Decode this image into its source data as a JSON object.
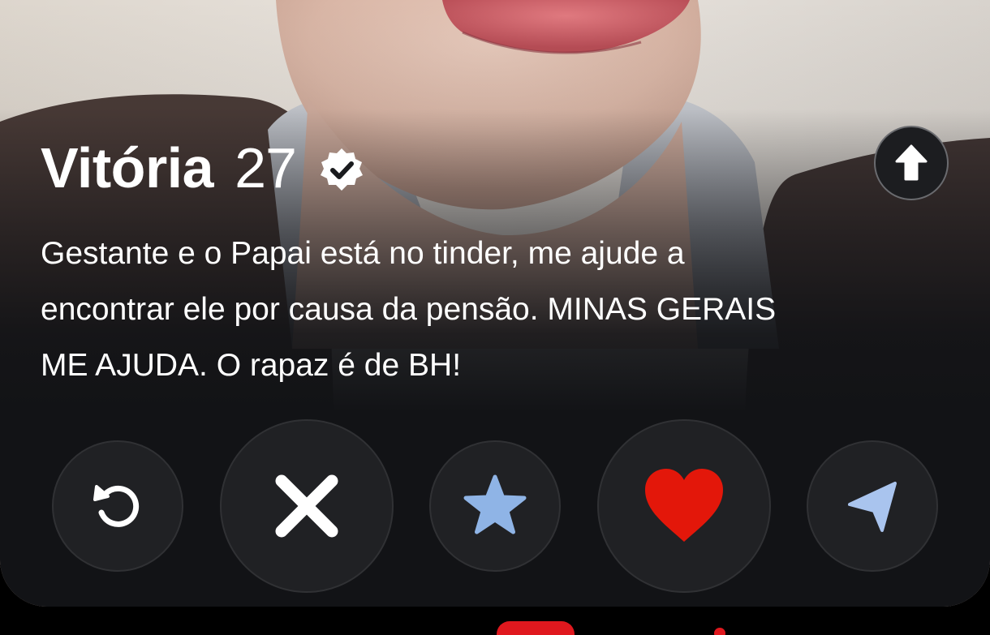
{
  "profile": {
    "name": "Vitória",
    "age": "27",
    "bio": "Gestante e o Papai está no tinder, me ajude a\nencontrar ele por causa da pensão. MINAS GERAIS\nME AJUDA. O rapaz é de BH!"
  },
  "icons": {
    "verified": "verified-badge-icon",
    "info": "arrow-up-icon",
    "rewind": "rewind-icon",
    "nope": "close-x-icon",
    "super_like": "star-icon",
    "like": "heart-icon",
    "boost": "send-arrow-icon"
  },
  "colors": {
    "background": "#000000",
    "card_bottom": "#121316",
    "button_fill": "#202124",
    "star": "#8fb4e6",
    "heart": "#e3170a",
    "boost": "#a9c4ee",
    "accent_red": "#e0181e"
  }
}
